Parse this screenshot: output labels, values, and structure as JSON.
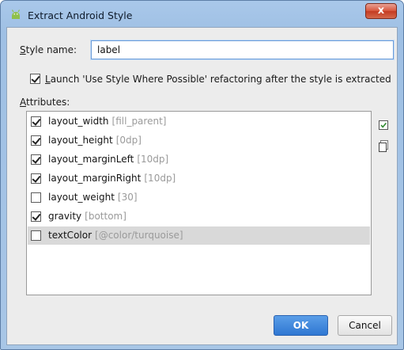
{
  "window": {
    "title": "Extract Android Style",
    "close_label": "x",
    "icon": "android-icon",
    "close_icon": "close-icon"
  },
  "style_name": {
    "label_prefix": "S",
    "label_rest": "tyle name:",
    "value": "label"
  },
  "refactor": {
    "checked": true,
    "label_prefix": "L",
    "label_rest": "aunch 'Use Style Where Possible' refactoring after the style is extracted"
  },
  "attributes": {
    "title_prefix": "A",
    "title_rest": "ttributes:",
    "items": [
      {
        "name": "layout_width",
        "value": "[fill_parent]",
        "checked": true,
        "selected": false
      },
      {
        "name": "layout_height",
        "value": "[0dp]",
        "checked": true,
        "selected": false
      },
      {
        "name": "layout_marginLeft",
        "value": "[10dp]",
        "checked": true,
        "selected": false
      },
      {
        "name": "layout_marginRight",
        "value": "[10dp]",
        "checked": true,
        "selected": false
      },
      {
        "name": "layout_weight",
        "value": "[30]",
        "checked": false,
        "selected": false
      },
      {
        "name": "gravity",
        "value": "[bottom]",
        "checked": true,
        "selected": false
      },
      {
        "name": "textColor",
        "value": "[@color/turquoise]",
        "checked": false,
        "selected": true
      }
    ],
    "select_all_icon": "select-all-icon",
    "deselect_all_icon": "deselect-all-icon"
  },
  "buttons": {
    "ok": "OK",
    "cancel": "Cancel"
  },
  "colors": {
    "titlebar": "#a9c8ea",
    "close": "#c43b22",
    "ok": "#2f77d2",
    "selected_row": "#d9d9d9"
  }
}
